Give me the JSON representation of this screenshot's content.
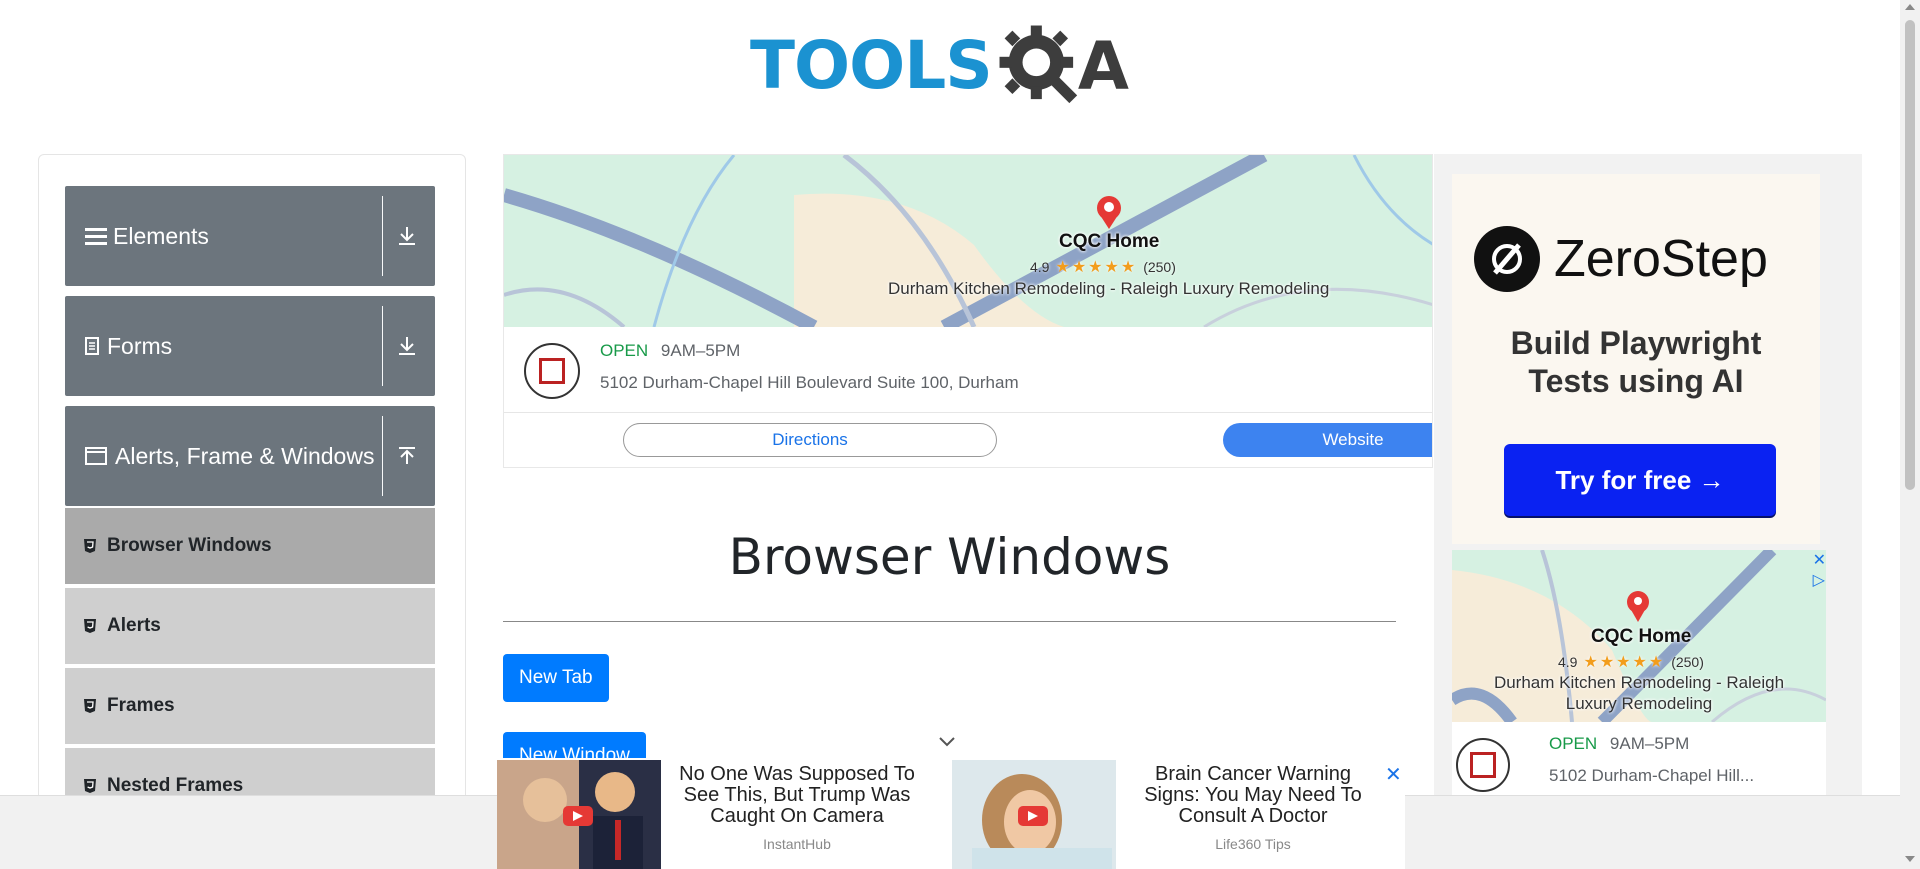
{
  "logo": {
    "text": "TOOLS",
    "qa_letter": "A"
  },
  "sidebar": {
    "groups": [
      {
        "label": "Elements",
        "icon": "hamburger-icon",
        "arrow": "download-arrow-icon"
      },
      {
        "label": "Forms",
        "icon": "document-icon",
        "arrow": "download-arrow-icon"
      },
      {
        "label": "Alerts, Frame & Windows",
        "icon": "window-icon",
        "arrow": "upload-arrow-icon"
      }
    ],
    "items": [
      {
        "label": "Browser Windows",
        "active": true
      },
      {
        "label": "Alerts"
      },
      {
        "label": "Frames"
      },
      {
        "label": "Nested Frames"
      }
    ]
  },
  "map_ad": {
    "business_name": "CQC Home",
    "rating": "4.9",
    "stars": "★★★★★",
    "reviews": "(250)",
    "subtitle": "Durham Kitchen Remodeling - Raleigh Luxury Remodeling",
    "status": "OPEN",
    "hours": "9AM–5PM",
    "address": "5102 Durham-Chapel Hill Boulevard Suite 100, Durham",
    "directions_label": "Directions",
    "website_label": "Website"
  },
  "main": {
    "title": "Browser Windows",
    "new_tab_label": "New Tab",
    "new_window_label": "New Window"
  },
  "right_ad": {
    "brand": "ZeroStep",
    "headline_line1": "Build Playwright",
    "headline_line2": "Tests using AI",
    "cta": "Try for free →",
    "map_business_name": "CQC Home",
    "map_rating": "4.9",
    "map_stars": "★★★★★",
    "map_reviews": "(250)",
    "map_subtitle_line1": "Durham Kitchen Remodeling - Raleigh",
    "map_subtitle_line2": "Luxury Remodeling",
    "status": "OPEN",
    "hours": "9AM–5PM",
    "address": "5102 Durham-Chapel Hill..."
  },
  "sticky_ad": {
    "story1_title_l1": "No One Was Supposed To",
    "story1_title_l2": "See This, But Trump Was",
    "story1_title_l3": "Caught On Camera",
    "story1_source": "InstantHub",
    "story2_title_l1": "Brain Cancer Warning",
    "story2_title_l2": "Signs: You May Need To",
    "story2_title_l3": "Consult A Doctor",
    "story2_source": "Life360 Tips",
    "close": "✕"
  },
  "colors": {
    "logo_blue": "#1b92d1",
    "sidebar_group": "#6c757d",
    "sidebar_item": "#cfcfcf",
    "sidebar_item_active": "#aaaaaa",
    "primary_button": "#007bff",
    "map_green": "#d6f1e2",
    "zerostep_cta": "#0a22f2"
  }
}
